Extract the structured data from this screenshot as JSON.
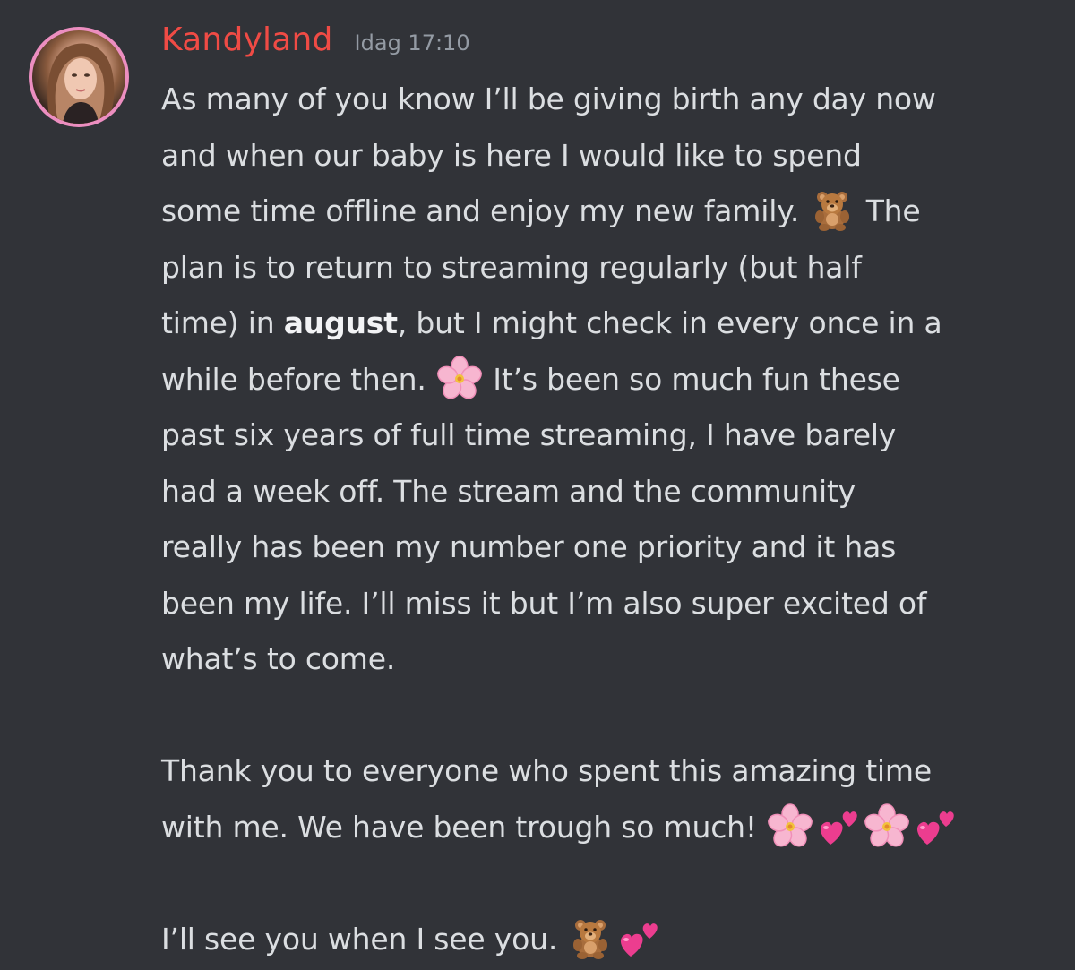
{
  "message": {
    "author": "Kandyland",
    "timestamp": "Idag 17:10",
    "author_color": "#f04b45",
    "avatar_ring_color": "#ec8ec0",
    "lines": {
      "l1": "As many of you know I’ll be giving birth any day now",
      "l2": "and when our baby is here I would like to spend",
      "l3a": "some time offline and enjoy my new family.",
      "l3b": "The",
      "l4": "plan is to return to streaming regularly (but half",
      "l5a": "time) in ",
      "l5bold": "august",
      "l5b": ", but I might check in every once in a",
      "l6a": "while before then.",
      "l6b": "It’s been so much fun these",
      "l7": "past six years of full time streaming, I have barely",
      "l8": "had a week off. The stream and the community",
      "l9": "really has been my number one priority and it has",
      "l10": "been my life. I’ll miss it but I’m also super excited of",
      "l11": "what’s to come.",
      "l12": "Thank you to everyone who spent this amazing time",
      "l13": "with me. We have been trough so much!",
      "l14": "I’ll see you when I see you."
    },
    "emojis": [
      "teddy-bear",
      "cherry-blossom",
      "cherry-blossom",
      "two-hearts",
      "cherry-blossom",
      "two-hearts",
      "teddy-bear",
      "two-hearts"
    ]
  }
}
